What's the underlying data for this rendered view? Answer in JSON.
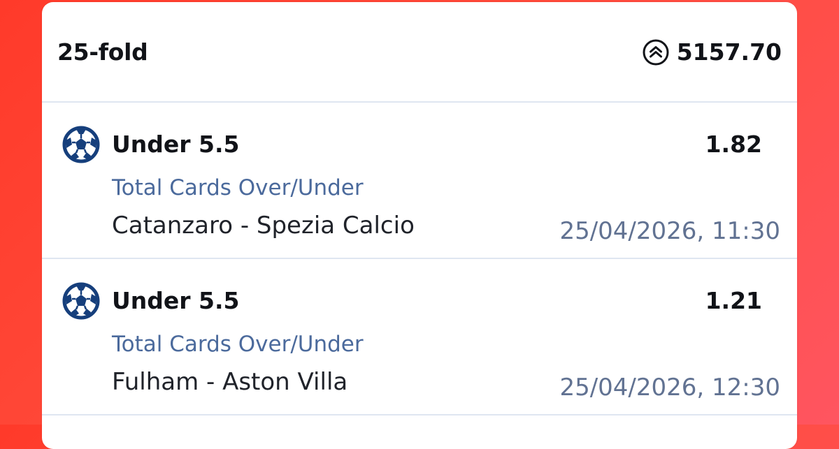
{
  "header": {
    "title": "25-fold",
    "stake_icon": "stake-coin-icon",
    "total_odds": "5157.70"
  },
  "bets": [
    {
      "sport_icon": "soccer-ball-icon",
      "selection": "Under 5.5",
      "odds": "1.82",
      "market": "Total Cards Over/Under",
      "event": "Catanzaro - Spezia Calcio",
      "datetime": "25/04/2026, 11:30"
    },
    {
      "sport_icon": "soccer-ball-icon",
      "selection": "Under 5.5",
      "odds": "1.21",
      "market": "Total Cards Over/Under",
      "event": "Fulham - Aston Villa",
      "datetime": "25/04/2026, 12:30"
    }
  ],
  "colors": {
    "background": "#ff4a3a",
    "card": "#ffffff",
    "icon_blue": "#163f7c",
    "market_text": "#4b6a9c",
    "date_text": "#617292"
  }
}
